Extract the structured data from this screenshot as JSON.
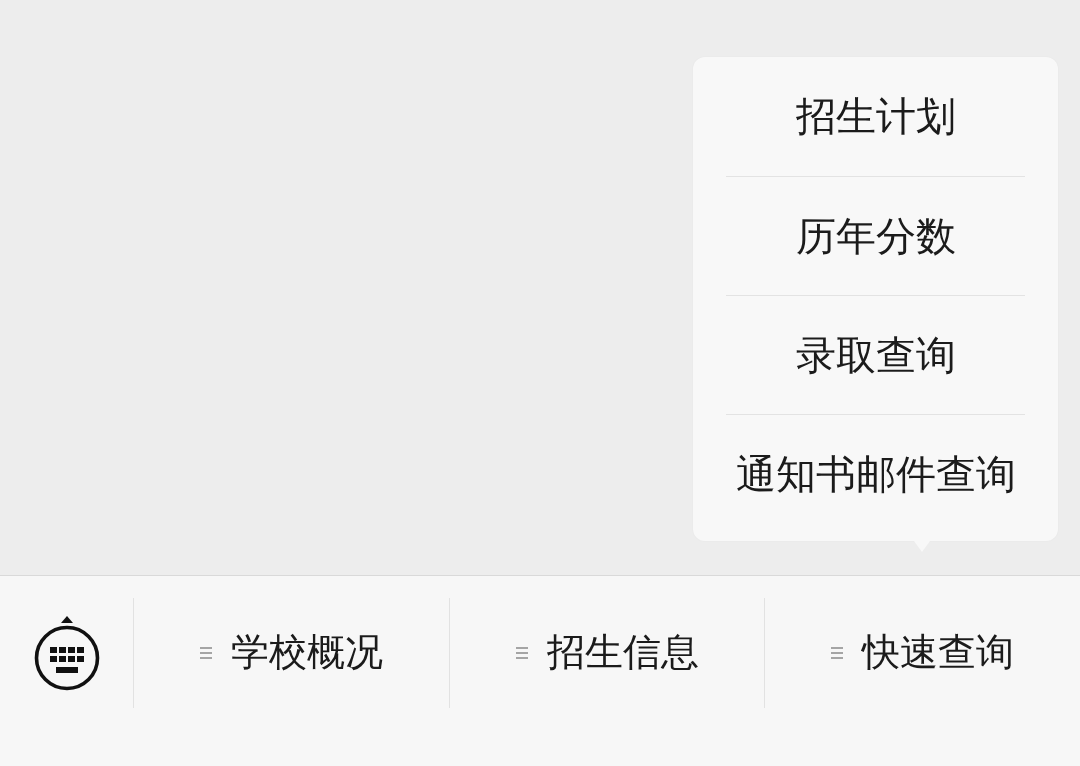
{
  "menu": [
    {
      "label": "学校概况"
    },
    {
      "label": "招生信息"
    },
    {
      "label": "快速查询",
      "submenu": [
        {
          "label": "招生计划"
        },
        {
          "label": "历年分数"
        },
        {
          "label": "录取查询"
        },
        {
          "label": "通知书邮件查询"
        }
      ]
    }
  ]
}
